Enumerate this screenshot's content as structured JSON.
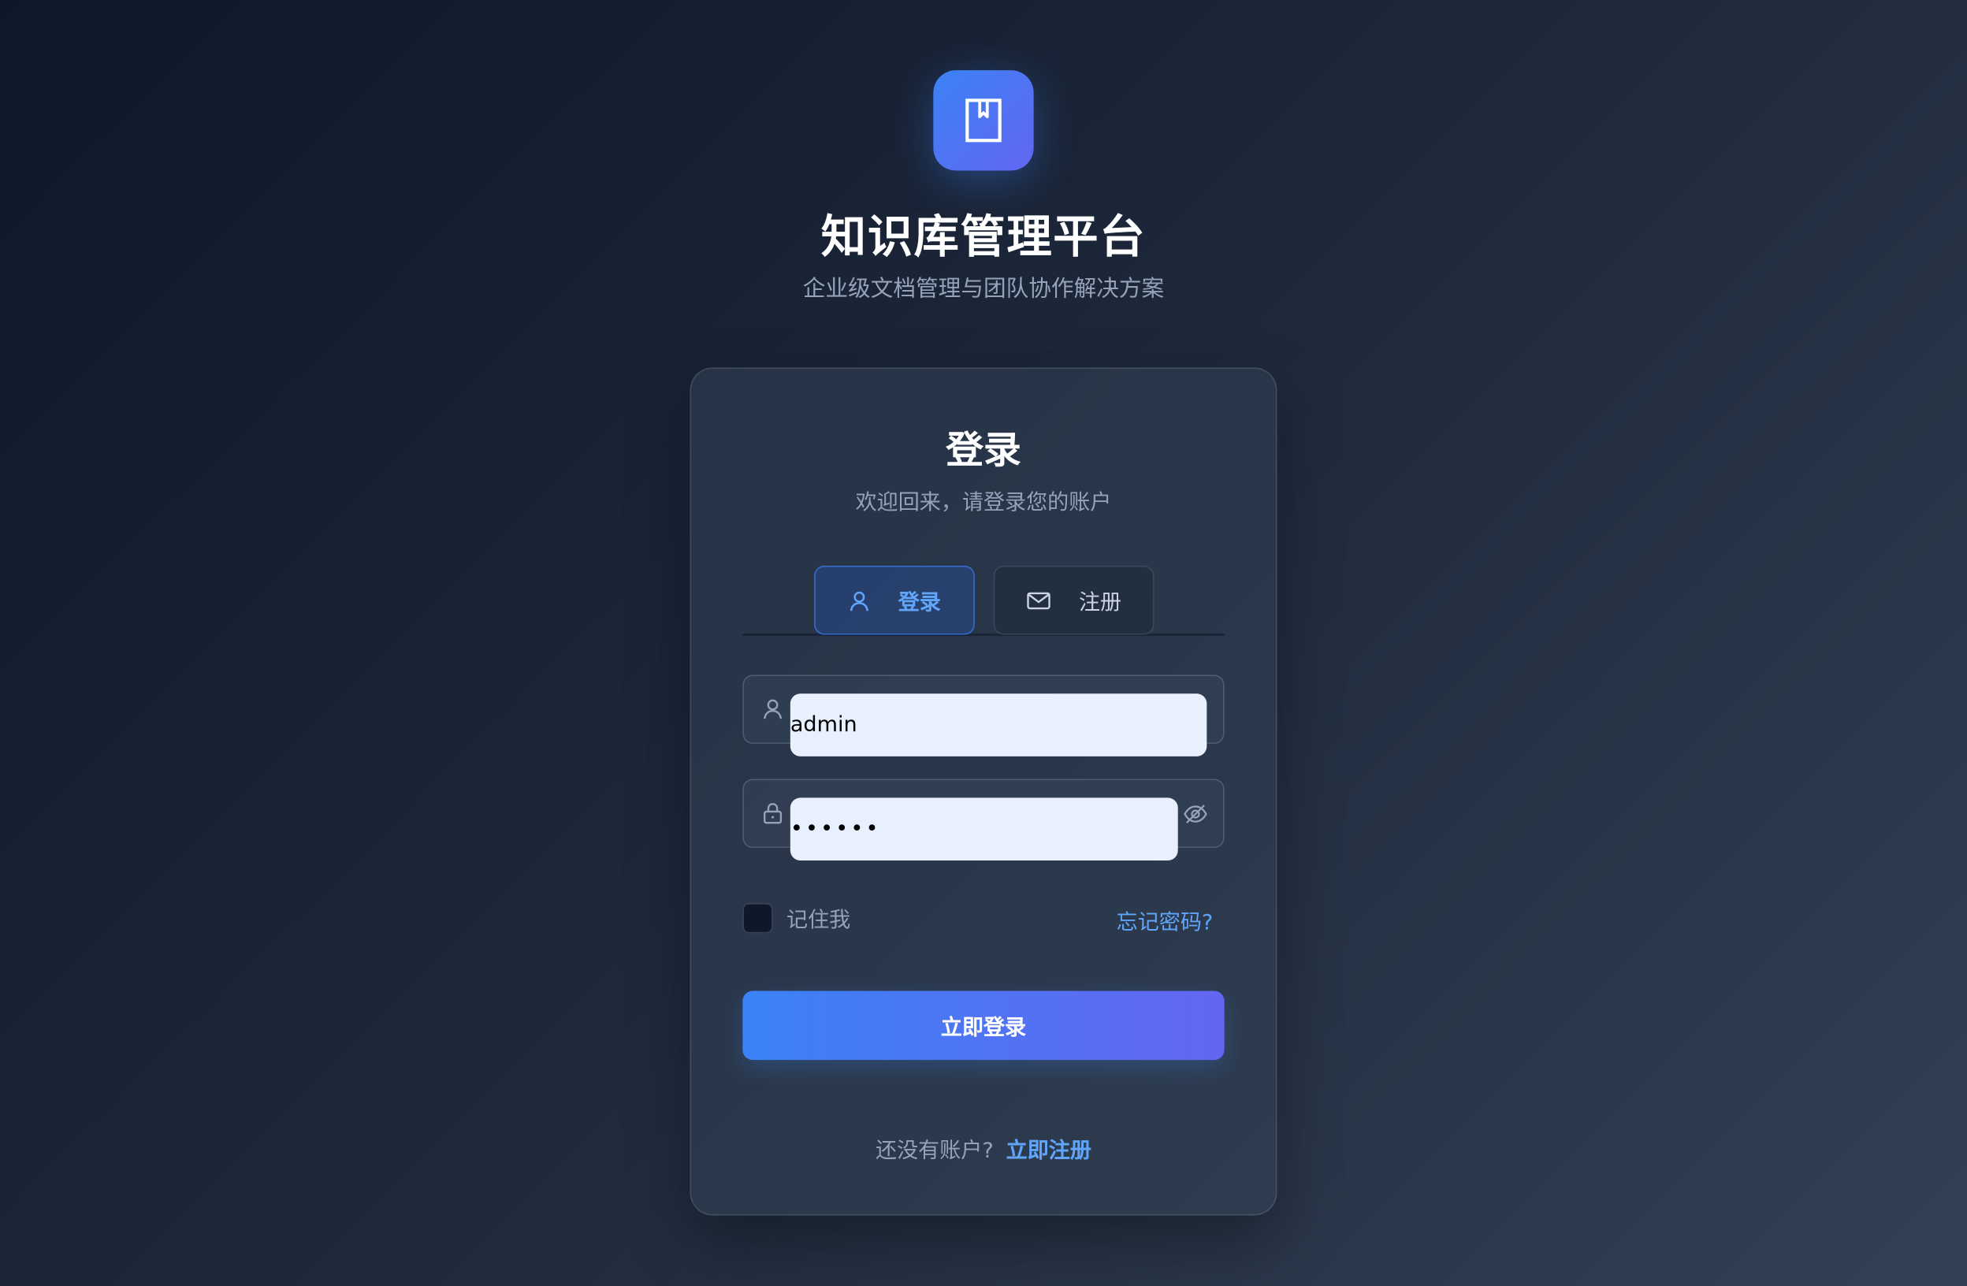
{
  "header": {
    "logo_icon": "book-bookmark-icon",
    "title": "知识库管理平台",
    "subtitle": "企业级文档管理与团队协作解决方案"
  },
  "card": {
    "title": "登录",
    "subtitle": "欢迎回来，请登录您的账户",
    "tabs": [
      {
        "label": "登录",
        "icon": "user-icon",
        "active": true
      },
      {
        "label": "注册",
        "icon": "mail-icon",
        "active": false
      }
    ],
    "username": {
      "value": "admin",
      "icon": "user-icon"
    },
    "password": {
      "value": "••••••",
      "icon": "lock-icon",
      "toggle_icon": "eye-off-icon"
    },
    "remember_label": "记住我",
    "forgot_label": "忘记密码?",
    "submit_label": "立即登录",
    "footer_question": "还没有账户?",
    "footer_link": "立即注册"
  },
  "colors": {
    "accent": "#3b82f6",
    "accent_2": "#6366f1",
    "link": "#60a5fa",
    "muted_text": "#94a3b8"
  }
}
